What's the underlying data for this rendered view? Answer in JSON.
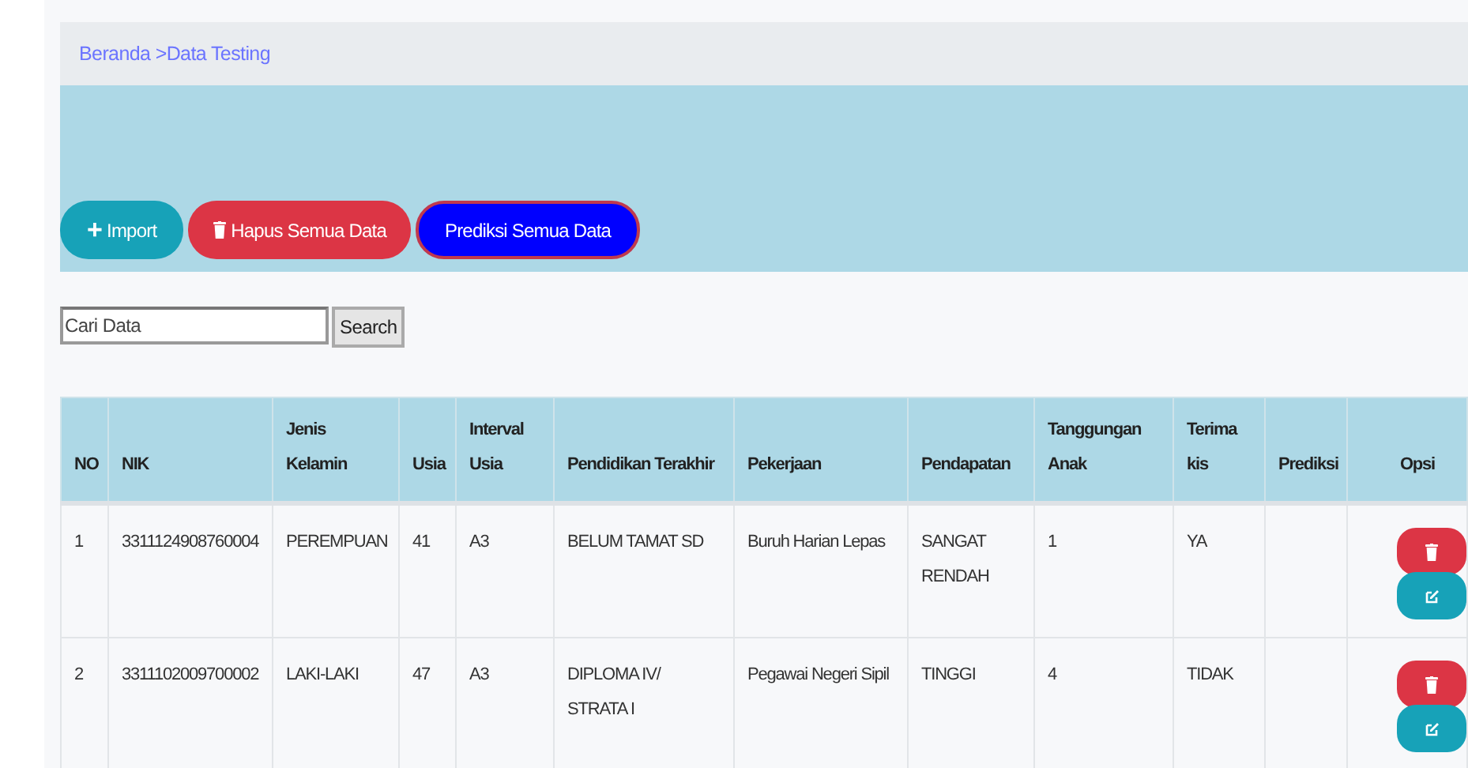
{
  "breadcrumb": {
    "text": "Beranda >Data Testing"
  },
  "actions": [
    {
      "kind": "import",
      "icon": "+",
      "label": "Import"
    },
    {
      "kind": "delete_all",
      "label": "Hapus Semua Data"
    },
    {
      "kind": "predict_all",
      "label": "Prediksi Semua Data"
    }
  ],
  "search": {
    "placeholder": "Cari Data",
    "button": "Search"
  },
  "table": {
    "columns": [
      {
        "label": "NO",
        "kind": "text"
      },
      {
        "label": "NIK",
        "kind": "text"
      },
      {
        "label": "Jenis Kelamin",
        "kind": "text"
      },
      {
        "label": "Usia",
        "kind": "text"
      },
      {
        "label": "Interval Usia",
        "kind": "text"
      },
      {
        "label": "Pendidikan Terakhir",
        "kind": "text"
      },
      {
        "label": "Pekerjaan",
        "kind": "text"
      },
      {
        "label": "Pendapatan",
        "kind": "text"
      },
      {
        "label": "Tanggungan Anak",
        "kind": "text"
      },
      {
        "label": "Terima kis",
        "kind": "text"
      },
      {
        "label": "Prediksi",
        "kind": "prediction"
      },
      {
        "label": "Opsi",
        "kind": "actions"
      }
    ],
    "rows": [
      {
        "cells": [
          "1",
          "3311124908760004",
          "PEREMPUAN",
          "41",
          "A3",
          "BELUM TAMAT SD",
          "Buruh Harian Lepas",
          "SANGAT RENDAH",
          "1",
          "YA"
        ]
      },
      {
        "cells": [
          "2",
          "3311102009700002",
          "LAKI-LAKI",
          "47",
          "A3",
          "DIPLOMA IV/ STRATA I",
          "Pegawai Negeri Sipil",
          "TINGGI",
          "4",
          "TIDAK"
        ]
      }
    ]
  }
}
